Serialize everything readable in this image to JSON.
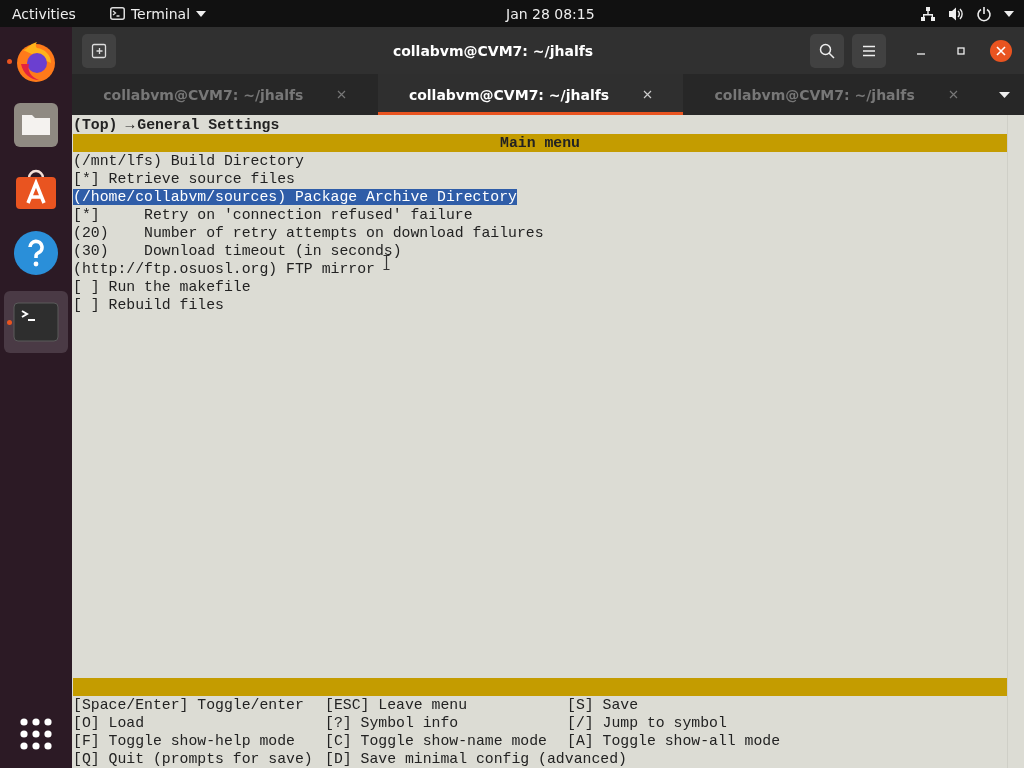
{
  "top_bar": {
    "activities": "Activities",
    "app_menu": "Terminal",
    "clock": "Jan 28  08:15"
  },
  "dock": {
    "items": [
      {
        "kind": "firefox",
        "running": true,
        "selected": false
      },
      {
        "kind": "files",
        "running": false,
        "selected": false
      },
      {
        "kind": "store",
        "running": false,
        "selected": false
      },
      {
        "kind": "help",
        "running": false,
        "selected": false
      },
      {
        "kind": "terminal",
        "running": true,
        "selected": true
      }
    ]
  },
  "window": {
    "title": "collabvm@CVM7: ~/jhalfs"
  },
  "tabs": [
    {
      "label": "collabvm@CVM7: ~/jhalfs",
      "selected": false
    },
    {
      "label": "collabvm@CVM7: ~/jhalfs",
      "selected": true
    },
    {
      "label": "collabvm@CVM7: ~/jhalfs",
      "selected": false
    }
  ],
  "terminal": {
    "breadcrumb_parent": "(Top)",
    "breadcrumb_arrow": "→",
    "breadcrumb_current": "General Settings",
    "menu_title": "Main menu",
    "items": [
      {
        "text": "(/mnt/lfs) Build Directory",
        "selected": false
      },
      {
        "text": "[*] Retrieve source files",
        "selected": false
      },
      {
        "text": "(/home/collabvm/sources) Package Archive Directory",
        "selected": true
      },
      {
        "text": "[*]     Retry on 'connection refused' failure",
        "selected": false
      },
      {
        "text": "(20)    Number of retry attempts on download failures",
        "selected": false
      },
      {
        "text": "(30)    Download timeout (in seconds)",
        "selected": false
      },
      {
        "text": "(http://ftp.osuosl.org) FTP mirror",
        "selected": false
      },
      {
        "text": "[ ] Run the makefile",
        "selected": false
      },
      {
        "text": "[ ] Rebuild files",
        "selected": false
      }
    ],
    "help": [
      [
        "[Space/Enter] Toggle/enter",
        "[ESC] Leave menu",
        "[S] Save"
      ],
      [
        "[O] Load",
        "[?] Symbol info",
        "[/] Jump to symbol"
      ],
      [
        "[F] Toggle show-help mode",
        "[C] Toggle show-name mode",
        "[A] Toggle show-all mode"
      ],
      [
        "[Q] Quit (prompts for save)",
        "[D] Save minimal config (advanced)"
      ]
    ]
  }
}
